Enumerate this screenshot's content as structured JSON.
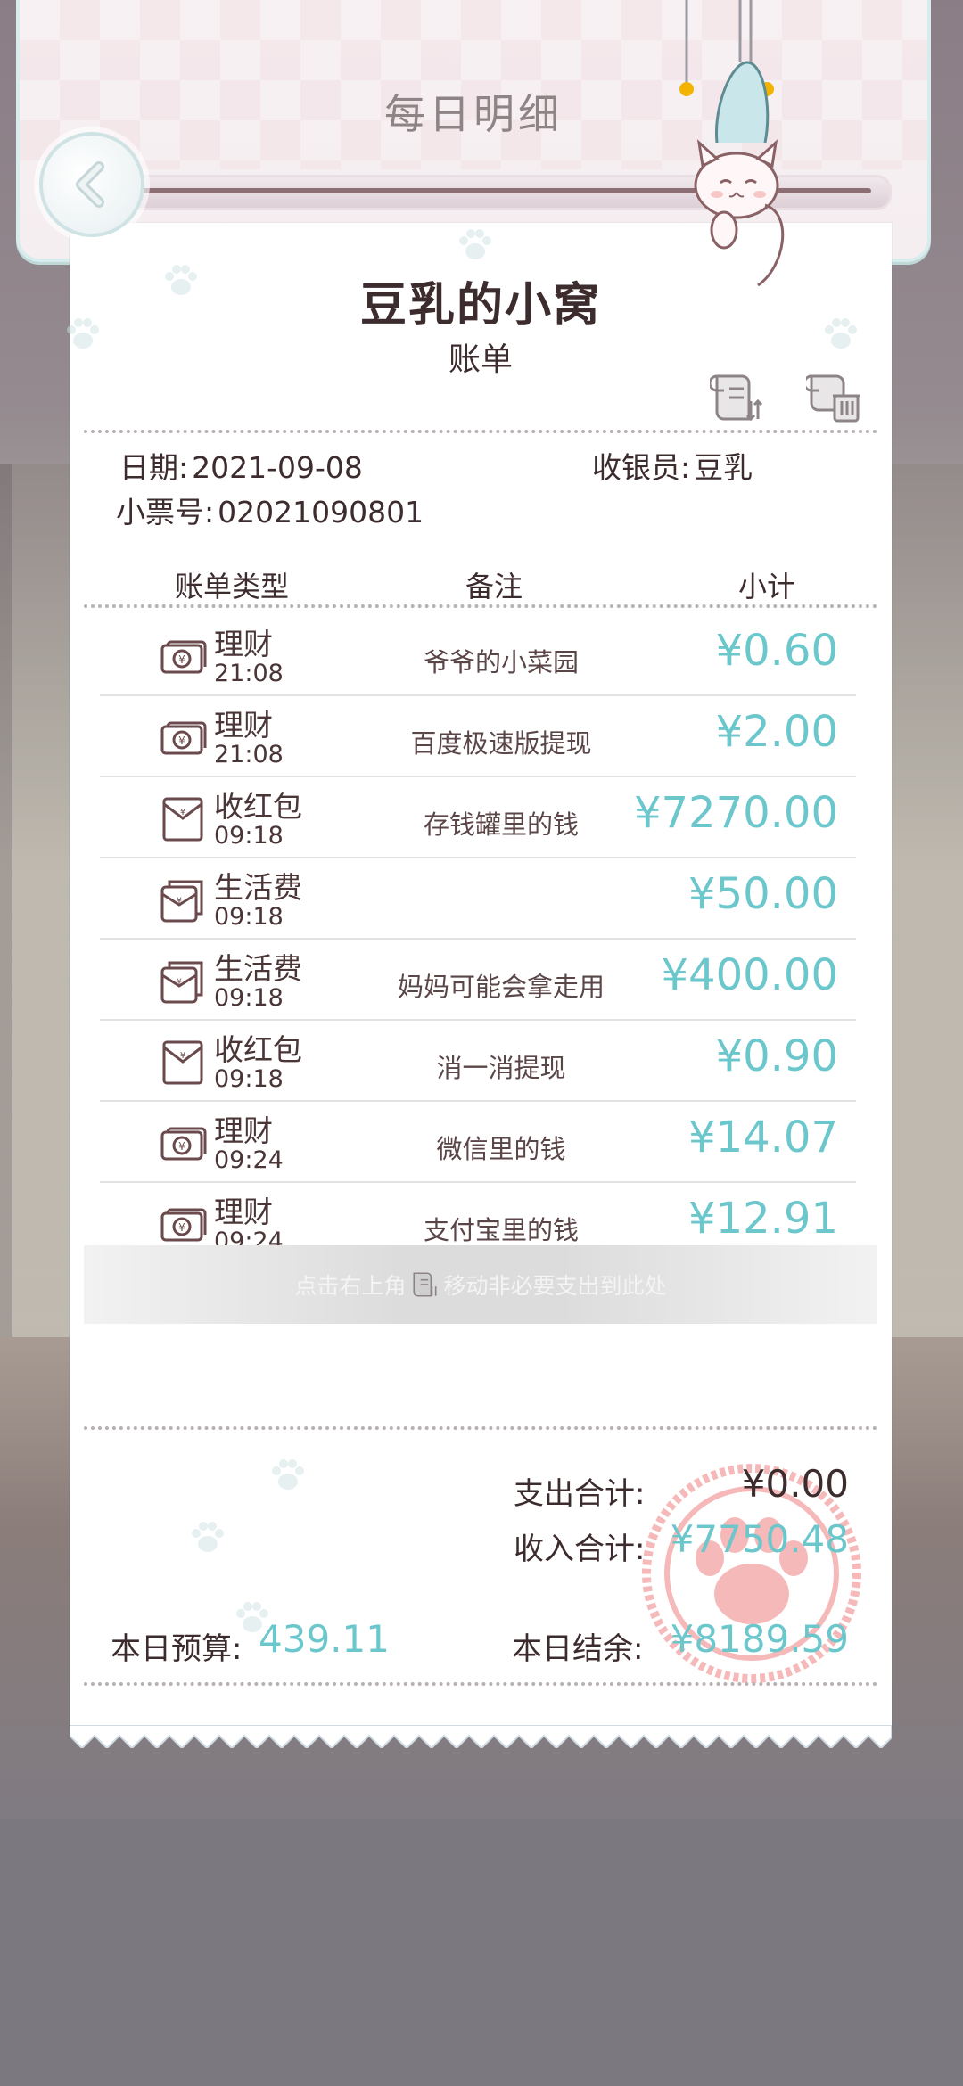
{
  "header": {
    "title": "每日明细"
  },
  "receipt": {
    "shop_name": "豆乳的小窝",
    "subtitle": "账单",
    "date_label": "日期:",
    "date_value": "2021-09-08",
    "cashier_label": "收银员:",
    "cashier_value": "豆乳",
    "ticket_label": "小票号:",
    "ticket_value": "02021090801",
    "columns": {
      "type": "账单类型",
      "note": "备注",
      "subtotal": "小计"
    },
    "rows": [
      {
        "type": "理财",
        "time": "21:08",
        "note": "爷爷的小菜园",
        "amount": "¥0.60",
        "icon": "finance-icon"
      },
      {
        "type": "理财",
        "time": "21:08",
        "note": "百度极速版提现",
        "amount": "¥2.00",
        "icon": "finance-icon"
      },
      {
        "type": "收红包",
        "time": "09:18",
        "note": "存钱罐里的钱",
        "amount": "¥7270.00",
        "icon": "red-envelope-icon"
      },
      {
        "type": "生活费",
        "time": "09:18",
        "note": "",
        "amount": "¥50.00",
        "icon": "living-allowance-icon"
      },
      {
        "type": "生活费",
        "time": "09:18",
        "note": "妈妈可能会拿走用",
        "amount": "¥400.00",
        "icon": "living-allowance-icon"
      },
      {
        "type": "收红包",
        "time": "09:18",
        "note": "消一消提现",
        "amount": "¥0.90",
        "icon": "red-envelope-icon"
      },
      {
        "type": "理财",
        "time": "09:24",
        "note": "微信里的钱",
        "amount": "¥14.07",
        "icon": "finance-icon"
      },
      {
        "type": "理财",
        "time": "09:24",
        "note": "支付宝里的钱",
        "amount": "¥12.91",
        "icon": "finance-icon"
      }
    ],
    "hint_before": "点击右上角",
    "hint_after": "移动非必要支出到此处",
    "expense_label": "支出合计:",
    "expense_value": "¥0.00",
    "income_label": "收入合计:",
    "income_value": "¥7750.48",
    "budget_label": "本日预算:",
    "budget_value": "439.11",
    "balance_label": "本日结余:",
    "balance_value": "¥8189.59"
  },
  "colors": {
    "amount": "#6bc7cc",
    "text": "#3d2c2e",
    "stamp": "#f08080"
  }
}
